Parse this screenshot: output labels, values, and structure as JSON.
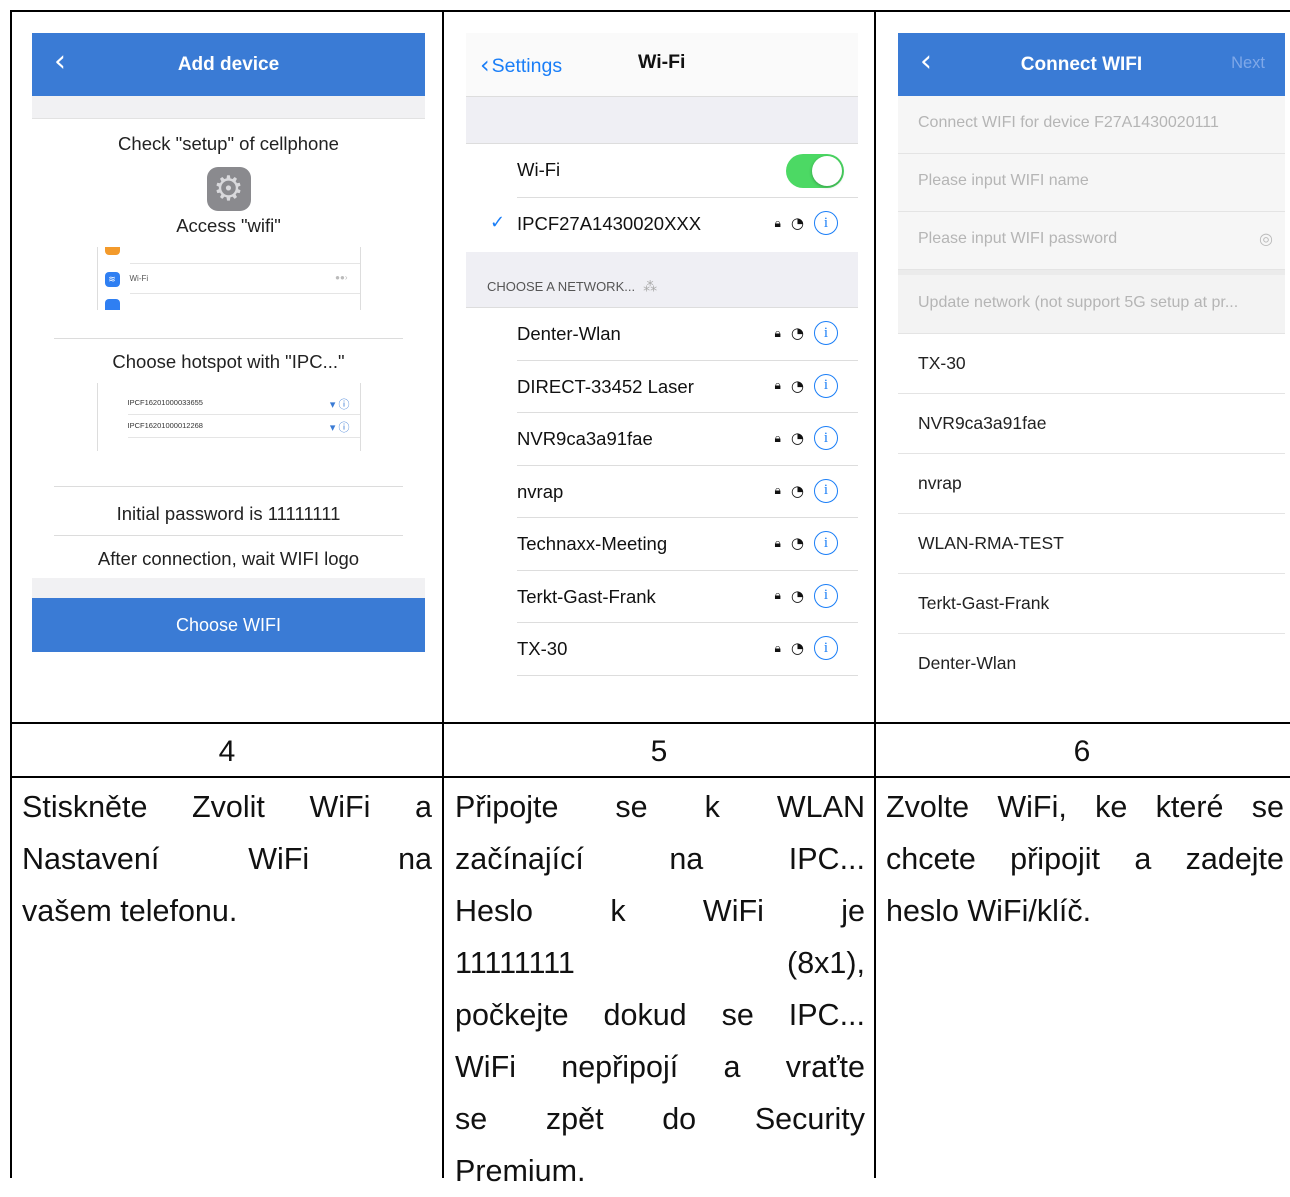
{
  "steps": [
    {
      "number": "4"
    },
    {
      "number": "5"
    },
    {
      "number": "6"
    }
  ],
  "descriptions": {
    "step4": [
      "Stiskněte Zvolit WiFi a",
      "Nastavení WiFi na",
      "vašem telefonu."
    ],
    "step5": [
      "Připojte se k WLAN",
      "začínající na IPC...",
      "Heslo k WiFi je",
      "11111111 (8x1),",
      "počkejte dokud se IPC...",
      "WiFi nepřipojí a vraťte",
      "se zpět do Security",
      "Premium."
    ],
    "step6": [
      "Zvolte WiFi, ke které se",
      "chcete připojit a zadejte",
      "heslo WiFi/klíč."
    ]
  },
  "screen1": {
    "title": "Add device",
    "check_setup": "Check \"setup\" of cellphone",
    "access_wifi": "Access \"wifi\"",
    "mini_wifi_label": "Wi-Fi",
    "choose_hotspot": "Choose hotspot with \"IPC...\"",
    "hotspots": [
      "IPCF16201000033655",
      "IPCF16201000012268"
    ],
    "initial_password": "Initial password is 11111111",
    "after_connection": "After connection, wait WIFI logo",
    "choose_button": "Choose WIFI",
    "accent": "#3a7bd5"
  },
  "screen2": {
    "back_label": "Settings",
    "title": "Wi-Fi",
    "wifi_label": "Wi-Fi",
    "wifi_on": true,
    "connected": "IPCF27A1430020XXX",
    "choose_header": "CHOOSE A NETWORK...",
    "networks": [
      "Denter-Wlan",
      "DIRECT-33452 Laser",
      "NVR9ca3a91fae",
      "nvrap",
      "Technaxx-Meeting",
      "Terkt-Gast-Frank",
      "TX-30"
    ],
    "toggle_color": "#4cd964",
    "link_color": "#1a7ef7"
  },
  "screen3": {
    "title": "Connect WIFI",
    "next_label": "Next",
    "connect_for": "Connect WIFI for device F27A1430020111",
    "name_placeholder": "Please input WIFI name",
    "password_placeholder": "Please input WIFI password",
    "update_network": "Update network (not support 5G setup at pr...",
    "networks": [
      "TX-30",
      "NVR9ca3a91fae",
      "nvrap",
      "WLAN-RMA-TEST",
      "Terkt-Gast-Frank",
      "Denter-Wlan"
    ]
  }
}
